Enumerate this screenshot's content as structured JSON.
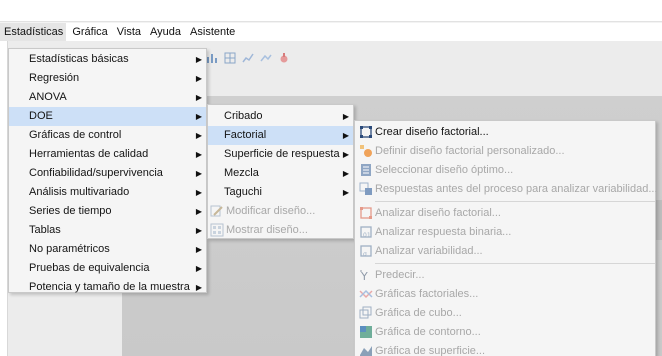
{
  "menubar": {
    "items": [
      "Estadísticas",
      "Gráfica",
      "Vista",
      "Ayuda",
      "Asistente"
    ]
  },
  "main_menu": {
    "items": [
      {
        "label": "Estadísticas básicas",
        "submenu": true
      },
      {
        "label": "Regresión",
        "submenu": true
      },
      {
        "label": "ANOVA",
        "submenu": true
      },
      {
        "label": "DOE",
        "submenu": true,
        "highlight": true
      },
      {
        "label": "Gráficas de control",
        "submenu": true
      },
      {
        "label": "Herramientas de calidad",
        "submenu": true
      },
      {
        "label": "Confiabilidad/supervivencia",
        "submenu": true
      },
      {
        "label": "Análisis multivariado",
        "submenu": true
      },
      {
        "label": "Series de tiempo",
        "submenu": true
      },
      {
        "label": "Tablas",
        "submenu": true
      },
      {
        "label": "No paramétricos",
        "submenu": true
      },
      {
        "label": "Pruebas de equivalencia",
        "submenu": true
      },
      {
        "label": "Potencia y tamaño de la muestra",
        "submenu": true
      }
    ]
  },
  "doe_menu": {
    "items": [
      {
        "label": "Cribado",
        "submenu": true
      },
      {
        "label": "Factorial",
        "submenu": true,
        "highlight": true
      },
      {
        "label": "Superficie de respuesta",
        "submenu": true
      },
      {
        "label": "Mezcla",
        "submenu": true
      },
      {
        "label": "Taguchi",
        "submenu": true
      },
      {
        "label": "Modificar diseño...",
        "disabled": true,
        "icon": "modify-design-icon"
      },
      {
        "label": "Mostrar diseño...",
        "disabled": true,
        "icon": "show-design-icon"
      }
    ]
  },
  "factorial_menu": {
    "items": [
      {
        "label": "Crear diseño factorial...",
        "disabled": false,
        "icon": "create-factorial-design-icon"
      },
      {
        "label": "Definir diseño factorial personalizado...",
        "disabled": true,
        "icon": "define-custom-design-icon"
      },
      {
        "label": "Seleccionar diseño óptimo...",
        "disabled": true,
        "icon": "select-optimal-design-icon"
      },
      {
        "label": "Respuestas antes del proceso para analizar variabilidad...",
        "disabled": true,
        "icon": "pre-process-responses-icon"
      },
      {
        "label": "Analizar diseño factorial...",
        "disabled": true,
        "icon": "analyze-factorial-design-icon"
      },
      {
        "label": "Analizar respuesta binaria...",
        "disabled": true,
        "icon": "analyze-binary-response-icon"
      },
      {
        "label": "Analizar variabilidad...",
        "disabled": true,
        "icon": "analyze-variability-icon"
      },
      {
        "label": "Predecir...",
        "disabled": true,
        "icon": "predict-icon"
      },
      {
        "label": "Gráficas factoriales...",
        "disabled": true,
        "icon": "factorial-plots-icon"
      },
      {
        "label": "Gráfica de cubo...",
        "disabled": true,
        "icon": "cube-plot-icon"
      },
      {
        "label": "Gráfica de contorno...",
        "disabled": true,
        "icon": "contour-plot-icon"
      },
      {
        "label": "Gráfica de superficie...",
        "disabled": true,
        "icon": "surface-plot-icon"
      }
    ]
  },
  "colors": {
    "highlight": "#cde0f7",
    "disabled_text": "#a8a8a8",
    "menu_bg": "#f5f5f5"
  }
}
